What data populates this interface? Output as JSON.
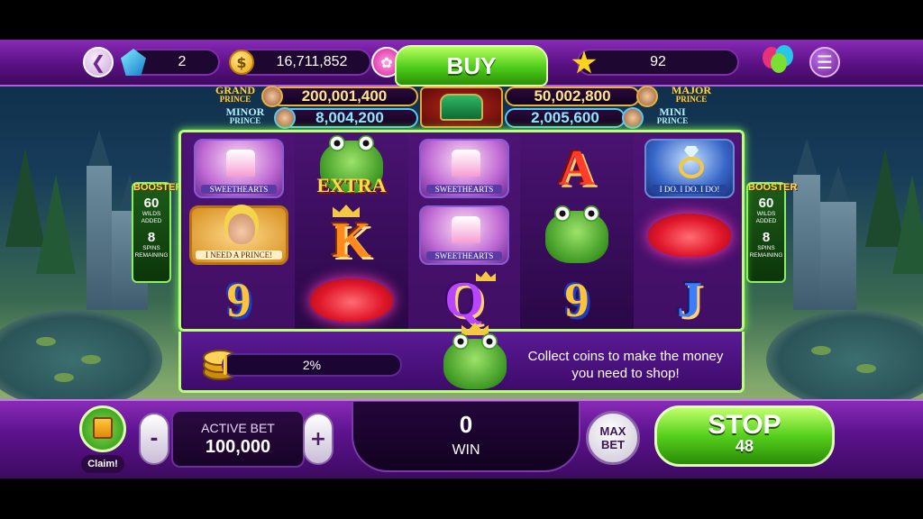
{
  "header": {
    "back_label": "❮",
    "gems": "2",
    "coins": "16,711,852",
    "coin_symbol": "$",
    "buy_label": "BUY",
    "stars": "92",
    "menu_label": "☰"
  },
  "jackpots": {
    "grand": {
      "label_line1": "GRAND",
      "label_line2": "PRINCE",
      "value": "200,001,400"
    },
    "major": {
      "label_line1": "MAJOR",
      "label_line2": "PRINCE",
      "value": "50,002,800"
    },
    "minor": {
      "label_line1": "MINOR",
      "label_line2": "PRINCE",
      "value": "8,004,200"
    },
    "mini": {
      "label_line1": "MINI",
      "label_line2": "PRINCE",
      "value": "2,005,600"
    }
  },
  "booster": {
    "title": "BOOSTER",
    "wilds_value": "60",
    "wilds_label_1": "WILDS",
    "wilds_label_2": "ADDED",
    "spins_value": "8",
    "spins_label_1": "SPINS",
    "spins_label_2": "REMAINING"
  },
  "reels": {
    "sweethearts_label": "SWEETHEARTS",
    "extra_label": "EXTRA",
    "prince_label": "I NEED A PRINCE!",
    "ring_label": "I DO. I DO. I DO!",
    "letter_K": "K",
    "letter_A": "A",
    "letter_Q": "Q",
    "letter_J": "J",
    "nine": "9"
  },
  "collect": {
    "progress_text": "2%",
    "progress_fraction": 0.02,
    "message": "Collect coins to make the money you need to shop!"
  },
  "footer": {
    "claim_label": "Claim!",
    "bet_title": "ACTIVE BET",
    "bet_value": "100,000",
    "minus_label": "-",
    "plus_label": "+",
    "win_value": "0",
    "win_label": "WIN",
    "maxbet_line1": "MAX",
    "maxbet_line2": "BET",
    "stop_label": "STOP",
    "stop_count": "48"
  },
  "colors": {
    "purple": "#5a1184",
    "green_accent": "#55cf1c",
    "gold": "#ffe58a"
  }
}
